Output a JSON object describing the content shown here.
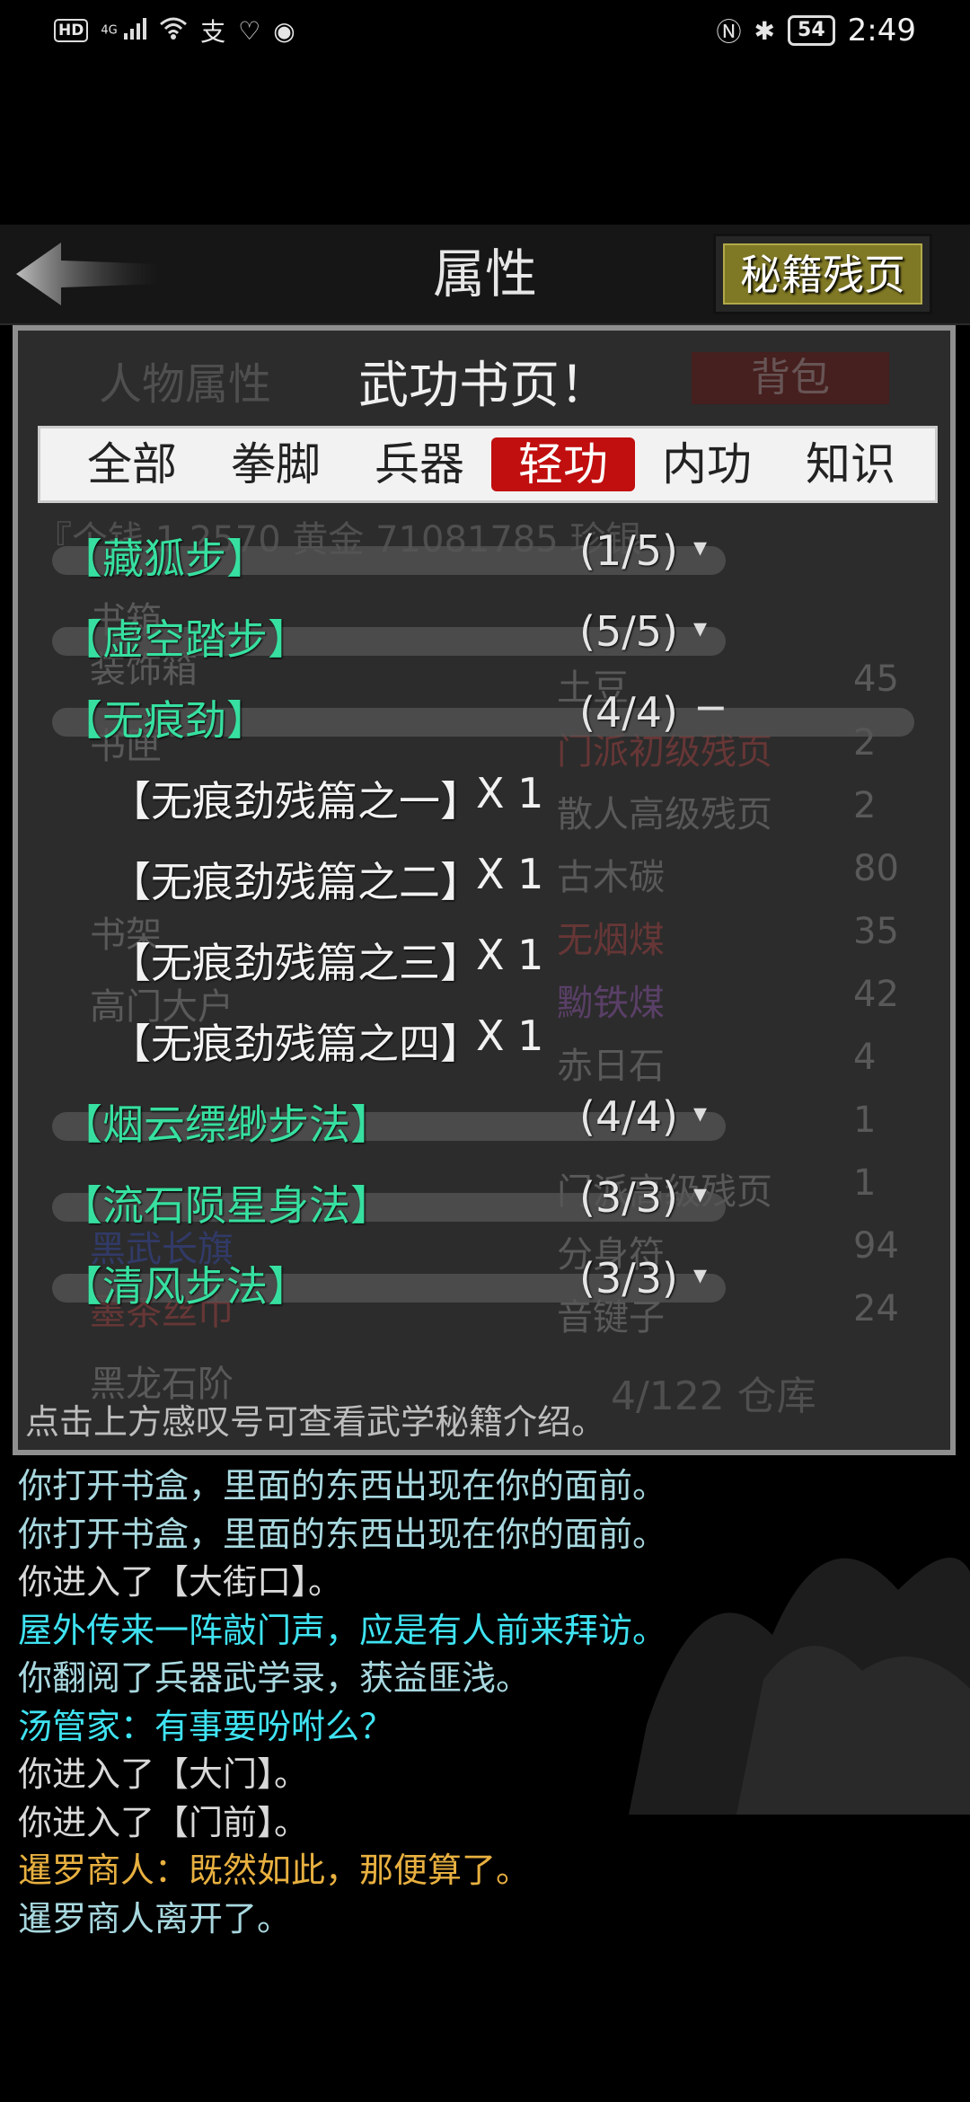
{
  "status_bar": {
    "left_badges": [
      "HD",
      "4G"
    ],
    "time": "2:49",
    "battery": "54",
    "icons": [
      "hd-icon",
      "signal-icon",
      "wifi-icon",
      "alipay-icon",
      "heart-icon",
      "sound-icon",
      "nfc-icon",
      "bluetooth-icon",
      "battery-icon"
    ]
  },
  "header": {
    "title": "属性",
    "secret_button": "秘籍残页"
  },
  "dialog": {
    "title": "武功书页！",
    "tabs": [
      {
        "label": "全部",
        "active": false
      },
      {
        "label": "拳脚",
        "active": false
      },
      {
        "label": "兵器",
        "active": false
      },
      {
        "label": "轻功",
        "active": true
      },
      {
        "label": "内功",
        "active": false
      },
      {
        "label": "知识",
        "active": false
      }
    ],
    "rows": [
      {
        "name": "【藏狐步】",
        "count": "(1/5)",
        "expanded": false
      },
      {
        "name": "【虚空踏步】",
        "count": "(5/5)",
        "expanded": false
      },
      {
        "name": "【无痕劲】",
        "count": "(4/4)",
        "expanded": true
      },
      {
        "name": "【烟云缥缈步法】",
        "count": "(4/4)",
        "expanded": false
      },
      {
        "name": "【流石陨星身法】",
        "count": "(3/3)",
        "expanded": false
      },
      {
        "name": "【清风步法】",
        "count": "(3/3)",
        "expanded": false
      }
    ],
    "sub_items": [
      {
        "name": "【无痕劲残篇之一】",
        "qty": "X 1"
      },
      {
        "name": "【无痕劲残篇之二】",
        "qty": "X 1"
      },
      {
        "name": "【无痕劲残篇之三】",
        "qty": "X 1"
      },
      {
        "name": "【无痕劲残篇之四】",
        "qty": "X 1"
      }
    ],
    "hint": "点击上方感叹号可查看武学秘籍介绍。"
  },
  "background_panel": {
    "tab_left": "人物属性",
    "tab_right": "背包",
    "money": "『个钱 1  2570 黄金 71081785 珍银",
    "left_items": [
      "书箱",
      "装饰箱",
      "书匣",
      "书架",
      "高门大户",
      "黑武长旗",
      "墨茶丝巾",
      "黑龙石阶"
    ],
    "right_items": [
      {
        "name": "土豆",
        "qty": "45"
      },
      {
        "name": "门派初级残页",
        "qty": "2"
      },
      {
        "name": "散人高级残页",
        "qty": "2"
      },
      {
        "name": "古木碳",
        "qty": "80"
      },
      {
        "name": "无烟煤",
        "qty": "35"
      },
      {
        "name": "黝铁煤",
        "qty": "42"
      },
      {
        "name": "赤日石",
        "qty": "4"
      },
      {
        "name": "",
        "qty": "1"
      },
      {
        "name": "门派高级残页",
        "qty": "1"
      },
      {
        "name": "分身符",
        "qty": "94"
      },
      {
        "name": "音键子",
        "qty": "24"
      }
    ],
    "footer": "4/122 仓库"
  },
  "log": [
    {
      "text": "你打开书盒，里面的东西出现在你的面前。",
      "color": "#a8d8df"
    },
    {
      "text": "你打开书盒，里面的东西出现在你的面前。",
      "color": "#a8d8df"
    },
    {
      "text": "你进入了【大街口】。",
      "color": "#d9d9d9"
    },
    {
      "text": "屋外传来一阵敲门声，应是有人前来拜访。",
      "color": "#3fe3f2"
    },
    {
      "text": "你翻阅了兵器武学录，获益匪浅。",
      "color": "#a8d8df"
    },
    {
      "text": "汤管家：有事要吩咐么？",
      "color": "#3fe3f2"
    },
    {
      "text": "你进入了【大门】。",
      "color": "#d9d9d9"
    },
    {
      "text": "你进入了【门前】。",
      "color": "#d9d9d9"
    },
    {
      "text": "暹罗商人：既然如此，那便算了。",
      "color": "#e8b040"
    },
    {
      "text": "暹罗商人离开了。",
      "color": "#a8d8df"
    }
  ]
}
